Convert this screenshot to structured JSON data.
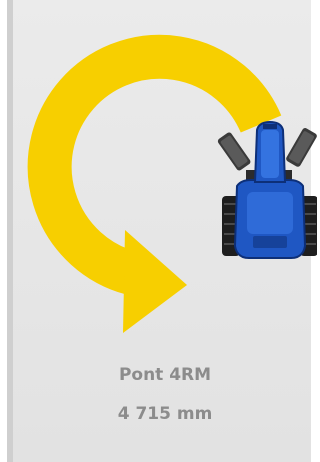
{
  "turning_radius": {
    "axle_type": "Pont 4RM",
    "radius": "4 715 mm"
  },
  "colors": {
    "arrow": "#f7cf00",
    "tractor_body": "#1f57c3",
    "tractor_dark": "#0d2f78",
    "tire": "#1e1e1e",
    "label": "#8c8c8c",
    "background": "#e8e8e8"
  },
  "icons": {
    "arrow": "turn-arrow-icon",
    "tractor": "tractor-icon"
  }
}
